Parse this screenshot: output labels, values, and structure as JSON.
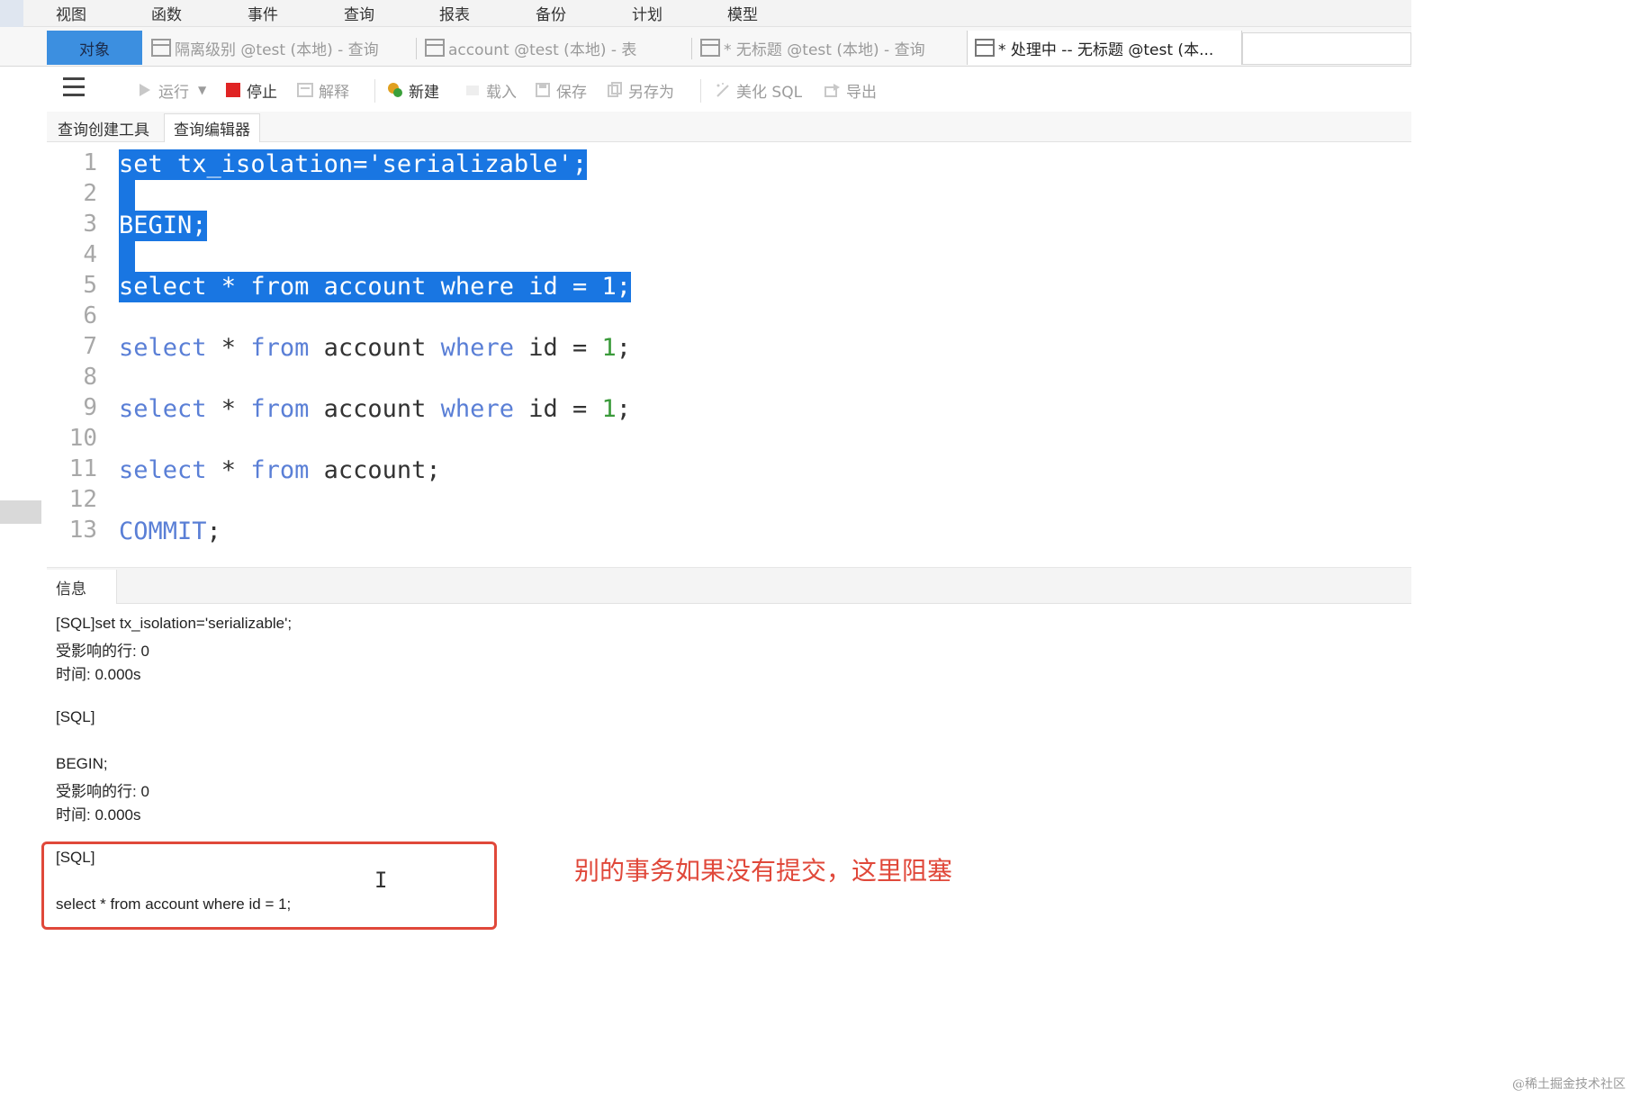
{
  "menubar": {
    "items": [
      "视图",
      "函数",
      "事件",
      "查询",
      "报表",
      "备份",
      "计划",
      "模型"
    ]
  },
  "tabs": {
    "objects": "对象",
    "items": [
      {
        "label": "隔离级别 @test (本地) - 查询"
      },
      {
        "label": "account @test (本地) - 表"
      },
      {
        "label": "* 无标题 @test (本地) - 查询"
      },
      {
        "label": "* 处理中 -- 无标题 @test (本..."
      }
    ]
  },
  "toolbar": {
    "run": "运行",
    "stop": "停止",
    "explain": "解释",
    "new": "新建",
    "load": "载入",
    "save": "保存",
    "save_as": "另存为",
    "beautify": "美化 SQL",
    "export": "导出"
  },
  "subtabs": {
    "builder": "查询创建工具",
    "editor": "查询编辑器"
  },
  "editor": {
    "line_numbers": [
      "1",
      "2",
      "3",
      "4",
      "5",
      "6",
      "7",
      "8",
      "9",
      "10",
      "11",
      "12",
      "13"
    ],
    "lines": {
      "l1": {
        "a": "set",
        "b": " tx_isolation='serializable';"
      },
      "l3": {
        "a": "BEGIN",
        "b": ";"
      },
      "l5": {
        "a": "select",
        "b": " * ",
        "c": "from",
        "d": " account ",
        "e": "where",
        "f": " id = ",
        "g": "1",
        "h": ";"
      },
      "l7": {
        "a": "select",
        "b": " * ",
        "c": "from",
        "d": " account ",
        "e": "where",
        "f": " id = ",
        "g": "1",
        "h": ";"
      },
      "l9": {
        "a": "select",
        "b": " * ",
        "c": "from",
        "d": " account ",
        "e": "where",
        "f": " id = ",
        "g": "1",
        "h": ";"
      },
      "l11": {
        "a": "select",
        "b": " * ",
        "c": "from",
        "d": " account;"
      },
      "l13": {
        "a": "COMMIT",
        "b": ";"
      }
    }
  },
  "info": {
    "tab": "信息",
    "log": [
      "[SQL]set tx_isolation='serializable';",
      "受影响的行: 0",
      "时间: 0.000s",
      "[SQL]",
      "BEGIN;",
      "受影响的行: 0",
      "时间: 0.000s",
      "[SQL]",
      "select * from account where id = 1;"
    ]
  },
  "annotation": "别的事务如果没有提交，这里阻塞",
  "watermark": "@稀土掘金技术社区",
  "colors": {
    "selection": "#1976e2",
    "keyword": "#5a7fd6",
    "number": "#3a9a3a",
    "annotation": "#e0483a",
    "objects_tab": "#3c8fe0"
  }
}
